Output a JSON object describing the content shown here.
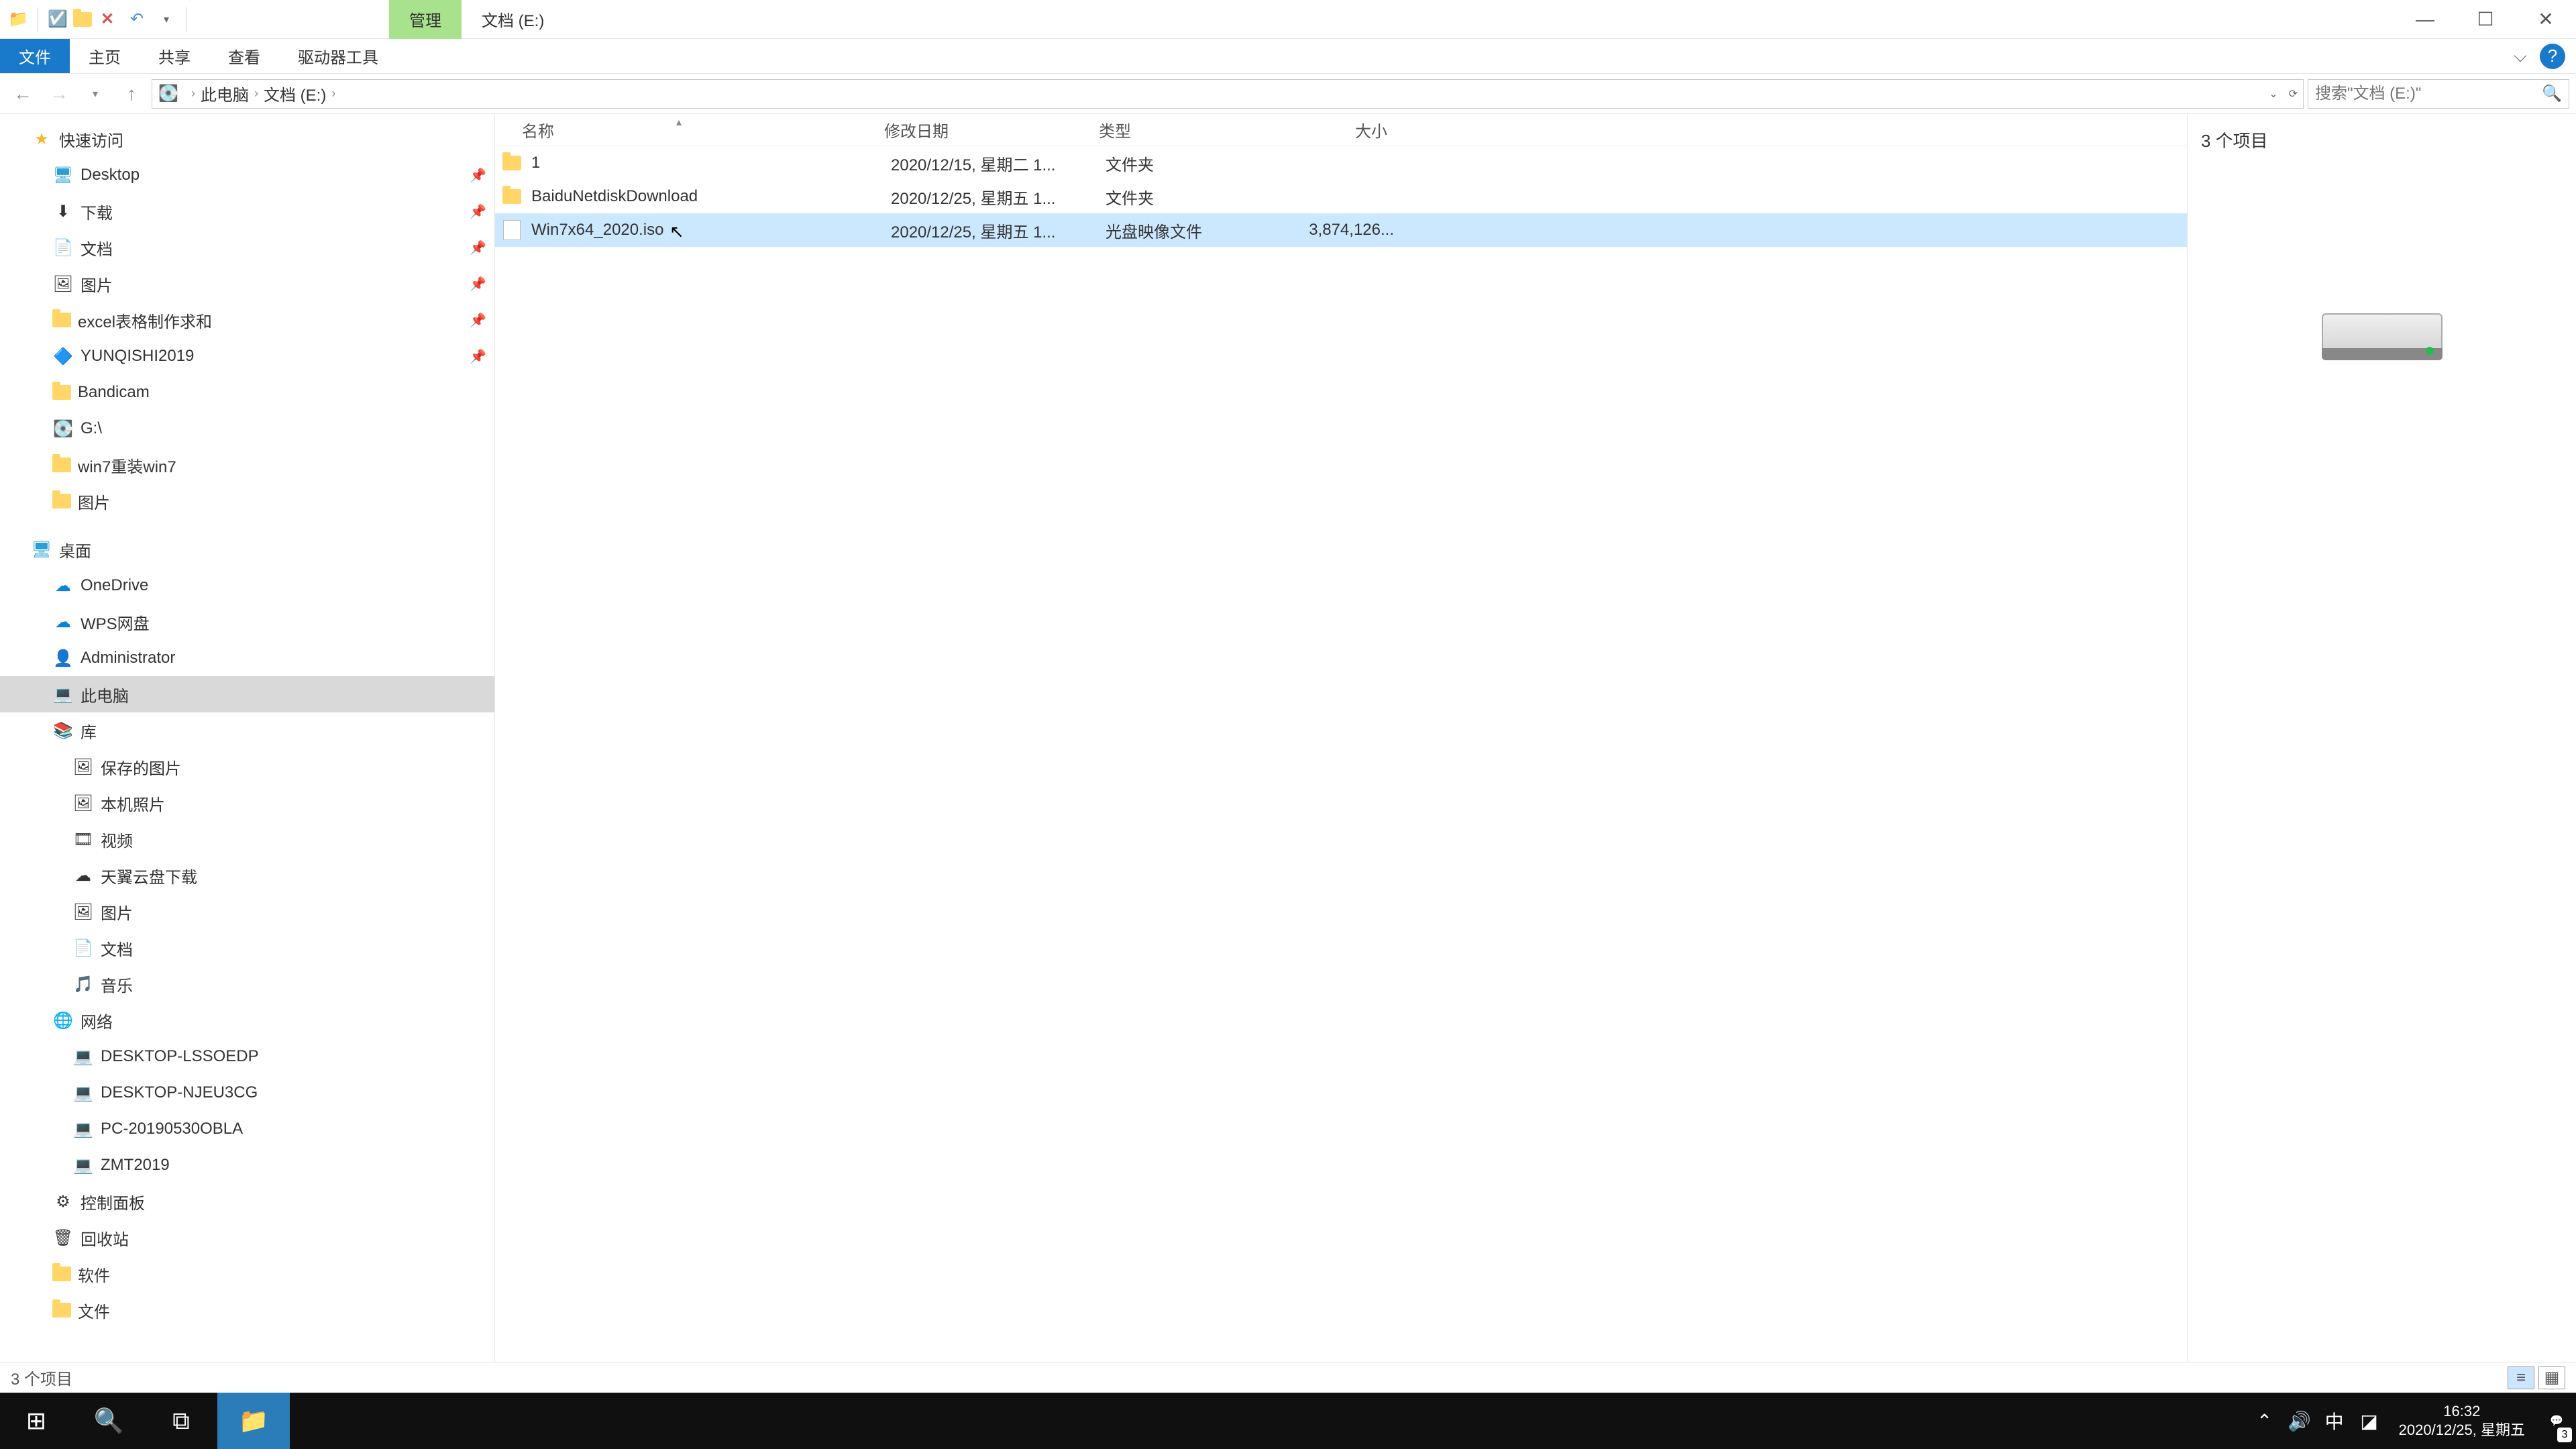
{
  "titlebar": {
    "context_tab": "管理",
    "location_label": "文档 (E:)"
  },
  "ribbon": {
    "file": "文件",
    "home": "主页",
    "share": "共享",
    "view": "查看",
    "drive_tools": "驱动器工具"
  },
  "address": {
    "seg1": "此电脑",
    "seg2": "文档 (E:)"
  },
  "search": {
    "placeholder": "搜索\"文档 (E:)\""
  },
  "nav": {
    "quick_access": "快速访问",
    "desktop": "Desktop",
    "downloads": "下载",
    "documents": "文档",
    "pictures": "图片",
    "excel": "excel表格制作求和",
    "yunqishi": "YUNQISHI2019",
    "bandicam": "Bandicam",
    "gdrive": "G:\\",
    "reinstall": "win7重装win7",
    "pics2": "图片",
    "desktop_cn": "桌面",
    "onedrive": "OneDrive",
    "wps": "WPS网盘",
    "admin": "Administrator",
    "this_pc": "此电脑",
    "library": "库",
    "saved_pics": "保存的图片",
    "camera_roll": "本机照片",
    "videos": "视频",
    "tianyi": "天翼云盘下载",
    "lib_pics": "图片",
    "lib_docs": "文档",
    "music": "音乐",
    "network": "网络",
    "pc1": "DESKTOP-LSSOEDP",
    "pc2": "DESKTOP-NJEU3CG",
    "pc3": "PC-20190530OBLA",
    "pc4": "ZMT2019",
    "cpanel": "控制面板",
    "recycle": "回收站",
    "software": "软件",
    "files": "文件"
  },
  "columns": {
    "name": "名称",
    "date": "修改日期",
    "type": "类型",
    "size": "大小"
  },
  "rows": [
    {
      "name": "1",
      "date": "2020/12/15, 星期二 1...",
      "type": "文件夹",
      "size": "",
      "icon": "folder",
      "selected": false
    },
    {
      "name": "BaiduNetdiskDownload",
      "date": "2020/12/25, 星期五 1...",
      "type": "文件夹",
      "size": "",
      "icon": "folder",
      "selected": false
    },
    {
      "name": "Win7x64_2020.iso",
      "date": "2020/12/25, 星期五 1...",
      "type": "光盘映像文件",
      "size": "3,874,126...",
      "icon": "iso",
      "selected": true
    }
  ],
  "preview": {
    "count_label": "3 个项目"
  },
  "status": {
    "items": "3 个项目"
  },
  "taskbar": {
    "time": "16:32",
    "date": "2020/12/25, 星期五",
    "ime": "中",
    "notif_count": "3"
  }
}
